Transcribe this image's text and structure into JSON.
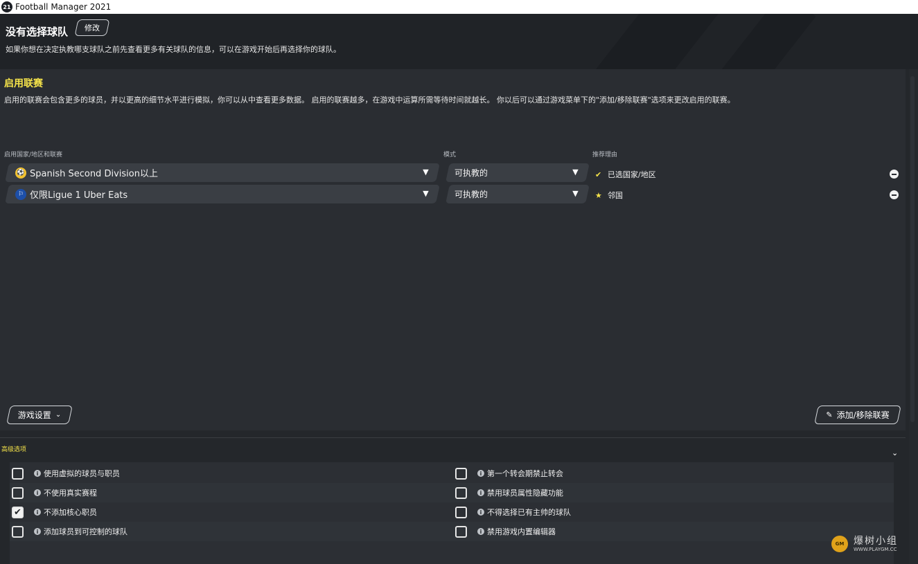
{
  "window": {
    "logo_text": "21",
    "title": "Football Manager 2021"
  },
  "header": {
    "team_title": "没有选择球队",
    "edit_label": "修改",
    "description": "如果你想在决定执教哪支球队之前先查看更多有关球队的信息，可以在游戏开始后再选择你的球队。"
  },
  "leagues_section": {
    "title": "启用联赛",
    "description": "启用的联赛会包含更多的球员，并以更高的细节水平进行模拟，你可以从中查看更多数据。 启用的联赛越多，在游戏中运算所需等待时间就越长。 你以后可以通过游戏菜单下的\"添加/移除联赛\"选项来更改启用的联赛。",
    "columns": {
      "league": "启用国家/地区和联赛",
      "mode": "模式",
      "reason": "推荐理由"
    },
    "rows": [
      {
        "league": "Spanish Second Division以上",
        "mode": "可执教的",
        "reason": "已选国家/地区",
        "reason_icon": "check-icon"
      },
      {
        "league": "仅限Ligue 1 Uber Eats",
        "mode": "可执教的",
        "reason": "邻国",
        "reason_icon": "star-icon"
      }
    ],
    "game_settings_label": "游戏设置",
    "add_remove_label": "添加/移除联赛"
  },
  "advanced": {
    "title": "高级选项",
    "left_options": [
      {
        "label": "使用虚拟的球员与职员",
        "checked": false
      },
      {
        "label": "不使用真实赛程",
        "checked": false
      },
      {
        "label": "不添加核心职员",
        "checked": true
      },
      {
        "label": "添加球员到可控制的球队",
        "checked": false
      }
    ],
    "right_options": [
      {
        "label": "第一个转会期禁止转会",
        "checked": false
      },
      {
        "label": "禁用球员属性隐藏功能",
        "checked": false
      },
      {
        "label": "不得选择已有主帅的球队",
        "checked": false
      },
      {
        "label": "禁用游戏内置编辑器",
        "checked": false
      }
    ]
  },
  "watermark": {
    "name": "爆树小组",
    "url": "WWW.PLAYGM.CC"
  },
  "colors": {
    "accent_yellow": "#f5e34a",
    "panel_bg": "#2a2d32",
    "select_bg": "#3a3e44"
  }
}
